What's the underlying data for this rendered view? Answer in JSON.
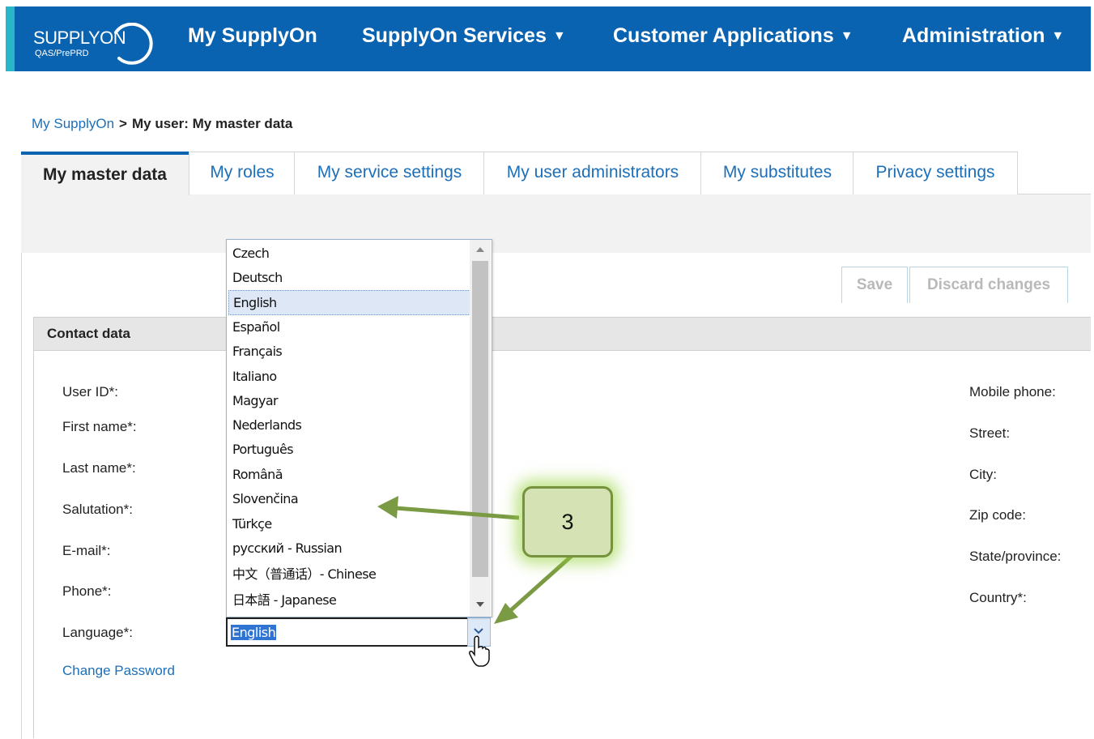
{
  "header": {
    "logo": {
      "brand": "SUPPLYON",
      "env": "QAS/PrePRD"
    },
    "nav": [
      {
        "label": "My SupplyOn",
        "dropdown": false
      },
      {
        "label": "SupplyOn Services",
        "dropdown": true
      },
      {
        "label": "Customer Applications",
        "dropdown": true
      },
      {
        "label": "Administration",
        "dropdown": true
      }
    ],
    "caret": "▼"
  },
  "breadcrumb": {
    "link": "My SupplyOn",
    "separator": ">",
    "current": "My user: My master data"
  },
  "tabs": [
    {
      "label": "My master data",
      "active": true
    },
    {
      "label": "My roles"
    },
    {
      "label": "My service settings"
    },
    {
      "label": "My user administrators"
    },
    {
      "label": "My substitutes"
    },
    {
      "label": "Privacy settings"
    }
  ],
  "toolbar": {
    "save_label": "Save",
    "discard_label": "Discard changes"
  },
  "section": {
    "title": "Contact data"
  },
  "left_fields": {
    "user_id": "User ID*:",
    "first_name": "First name*:",
    "last_name": "Last name*:",
    "salutation": "Salutation*:",
    "email": "E-mail*:",
    "phone": "Phone*:",
    "language": "Language*:"
  },
  "right_fields": {
    "mobile": "Mobile phone:",
    "street": "Street:",
    "city": "City:",
    "zip": "Zip code:",
    "state": "State/province:",
    "country": "Country*:"
  },
  "change_password": "Change Password",
  "language_select": {
    "value": "English",
    "options": [
      "Czech",
      "Deutsch",
      "English",
      "Español",
      "Français",
      "Italiano",
      "Magyar",
      "Nederlands",
      "Português",
      "Română",
      "Slovenčina",
      "Türkçe",
      "русский - Russian",
      "中文（普通话）- Chinese",
      "日本語 - Japanese"
    ],
    "highlighted": "English"
  },
  "callout": {
    "label": "3"
  },
  "colors": {
    "nav_bg": "#0a63b0",
    "accent": "#27b7c9",
    "link": "#1c6fb8",
    "callout_fill": "#d5e2b3",
    "callout_border": "#76923c",
    "arrow": "#7a9a44"
  },
  "icons": [
    "chevron-down-icon",
    "hand-cursor-icon",
    "scroll-up-icon",
    "scroll-down-icon"
  ]
}
